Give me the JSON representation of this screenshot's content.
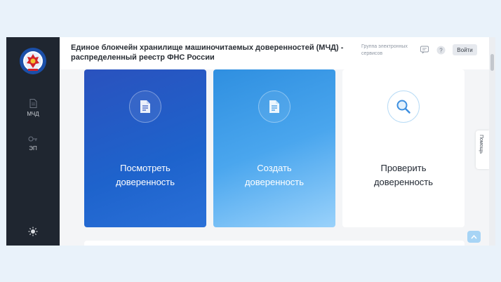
{
  "sidebar": {
    "items": [
      {
        "label": "МЧД",
        "icon": "document-icon"
      },
      {
        "label": "ЭП",
        "icon": "key-icon"
      }
    ],
    "theme_icon": "sun-icon"
  },
  "header": {
    "title_line1": "Единое блокчейн хранилище машиночитаемых доверенностей (МЧД) -",
    "title_line2": "распределенный реестр ФНС России",
    "service_group_line1": "Группа электронных",
    "service_group_line2": "сервисов",
    "login_label": "Войти"
  },
  "cards": [
    {
      "line1": "Посмотреть",
      "line2": "доверенность",
      "icon": "document-icon"
    },
    {
      "line1": "Создать",
      "line2": "доверенность",
      "icon": "document-icon"
    },
    {
      "line1": "Проверить",
      "line2": "доверенность",
      "icon": "magnifier-icon"
    }
  ],
  "help_label": "Помощь",
  "colors": {
    "sidebar_bg": "#1f2630",
    "card_blue": "#2a52be",
    "card_light_blue": "#4aa6ee",
    "accent": "#3d8fe0"
  }
}
